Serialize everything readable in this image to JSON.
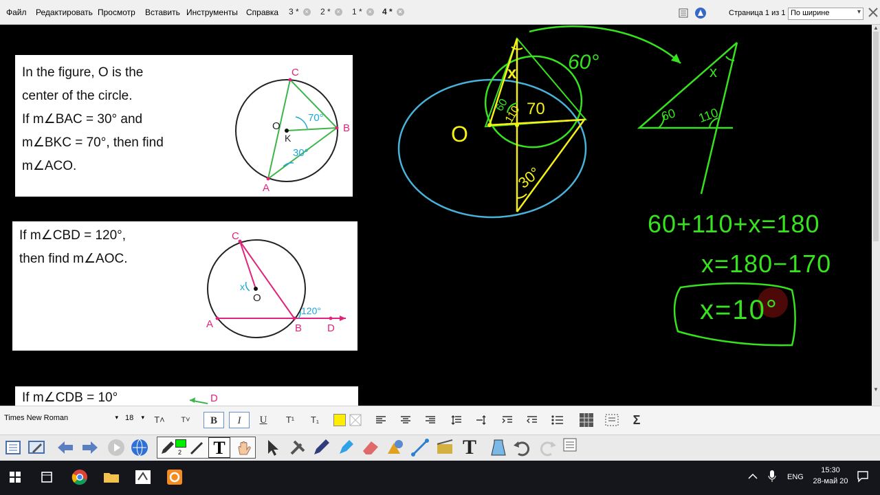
{
  "menu": [
    "Файл",
    "Редактировать",
    "Просмотр",
    "Вставить",
    "Инструменты",
    "Справка"
  ],
  "tabs": [
    {
      "label": "3 *",
      "active": false
    },
    {
      "label": "2 *",
      "active": false
    },
    {
      "label": "1 *",
      "active": false
    },
    {
      "label": "4 *",
      "active": true
    }
  ],
  "page_indicator": "Страница 1 из 1",
  "zoom": "По ширине",
  "problems": [
    {
      "lines": [
        "In the figure, O is the",
        "center of the circle.",
        "If m∠BAC = 30° and",
        "m∠BKC = 70°, then find",
        "m∠ACO."
      ],
      "figure": {
        "labels": {
          "C": "C",
          "B": "B",
          "A": "A",
          "O": "O",
          "K": "K",
          "angle1": "70°",
          "angle2": "30°"
        }
      }
    },
    {
      "lines": [
        "If m∠CBD = 120°,",
        "then find m∠AOC."
      ],
      "figure": {
        "labels": {
          "C": "C",
          "A": "A",
          "B": "B",
          "D": "D",
          "O": "O",
          "x": "x",
          "angle": "120°"
        }
      }
    },
    {
      "lines": [
        "If m∠CDB = 10°"
      ],
      "figure": {
        "labels": {
          "D": "D"
        }
      }
    }
  ],
  "handwriting": {
    "angle_60_top": "60°",
    "x_top": "x",
    "label_60": "60",
    "label_110": "110",
    "label_70": "70",
    "label_O": "O",
    "label_30": "30°",
    "tri_x": "x",
    "tri_60": "60",
    "tri_110": "110",
    "eq1": "60+110+x=180",
    "eq2": "x=180−170",
    "answer": "x=10°"
  },
  "format_toolbar": {
    "font": "Times New Roman",
    "size": "18",
    "bold": "B",
    "italic": "I",
    "underline": "U",
    "superscript": "T¹",
    "subscript": "T₁",
    "sum": "Σ"
  },
  "toolbar": {
    "pen_width": "2",
    "text_tool": "T"
  },
  "taskbar": {
    "lang": "ENG",
    "time": "15:30",
    "date": "28-май 20"
  },
  "colors": {
    "ink_green": "#37e21f",
    "ink_yellow": "#f6f016",
    "ink_cyan": "#48b3d9",
    "figure_green": "#3db54a",
    "figure_cyan": "#1fa7d8",
    "figure_magenta": "#e0237c"
  }
}
